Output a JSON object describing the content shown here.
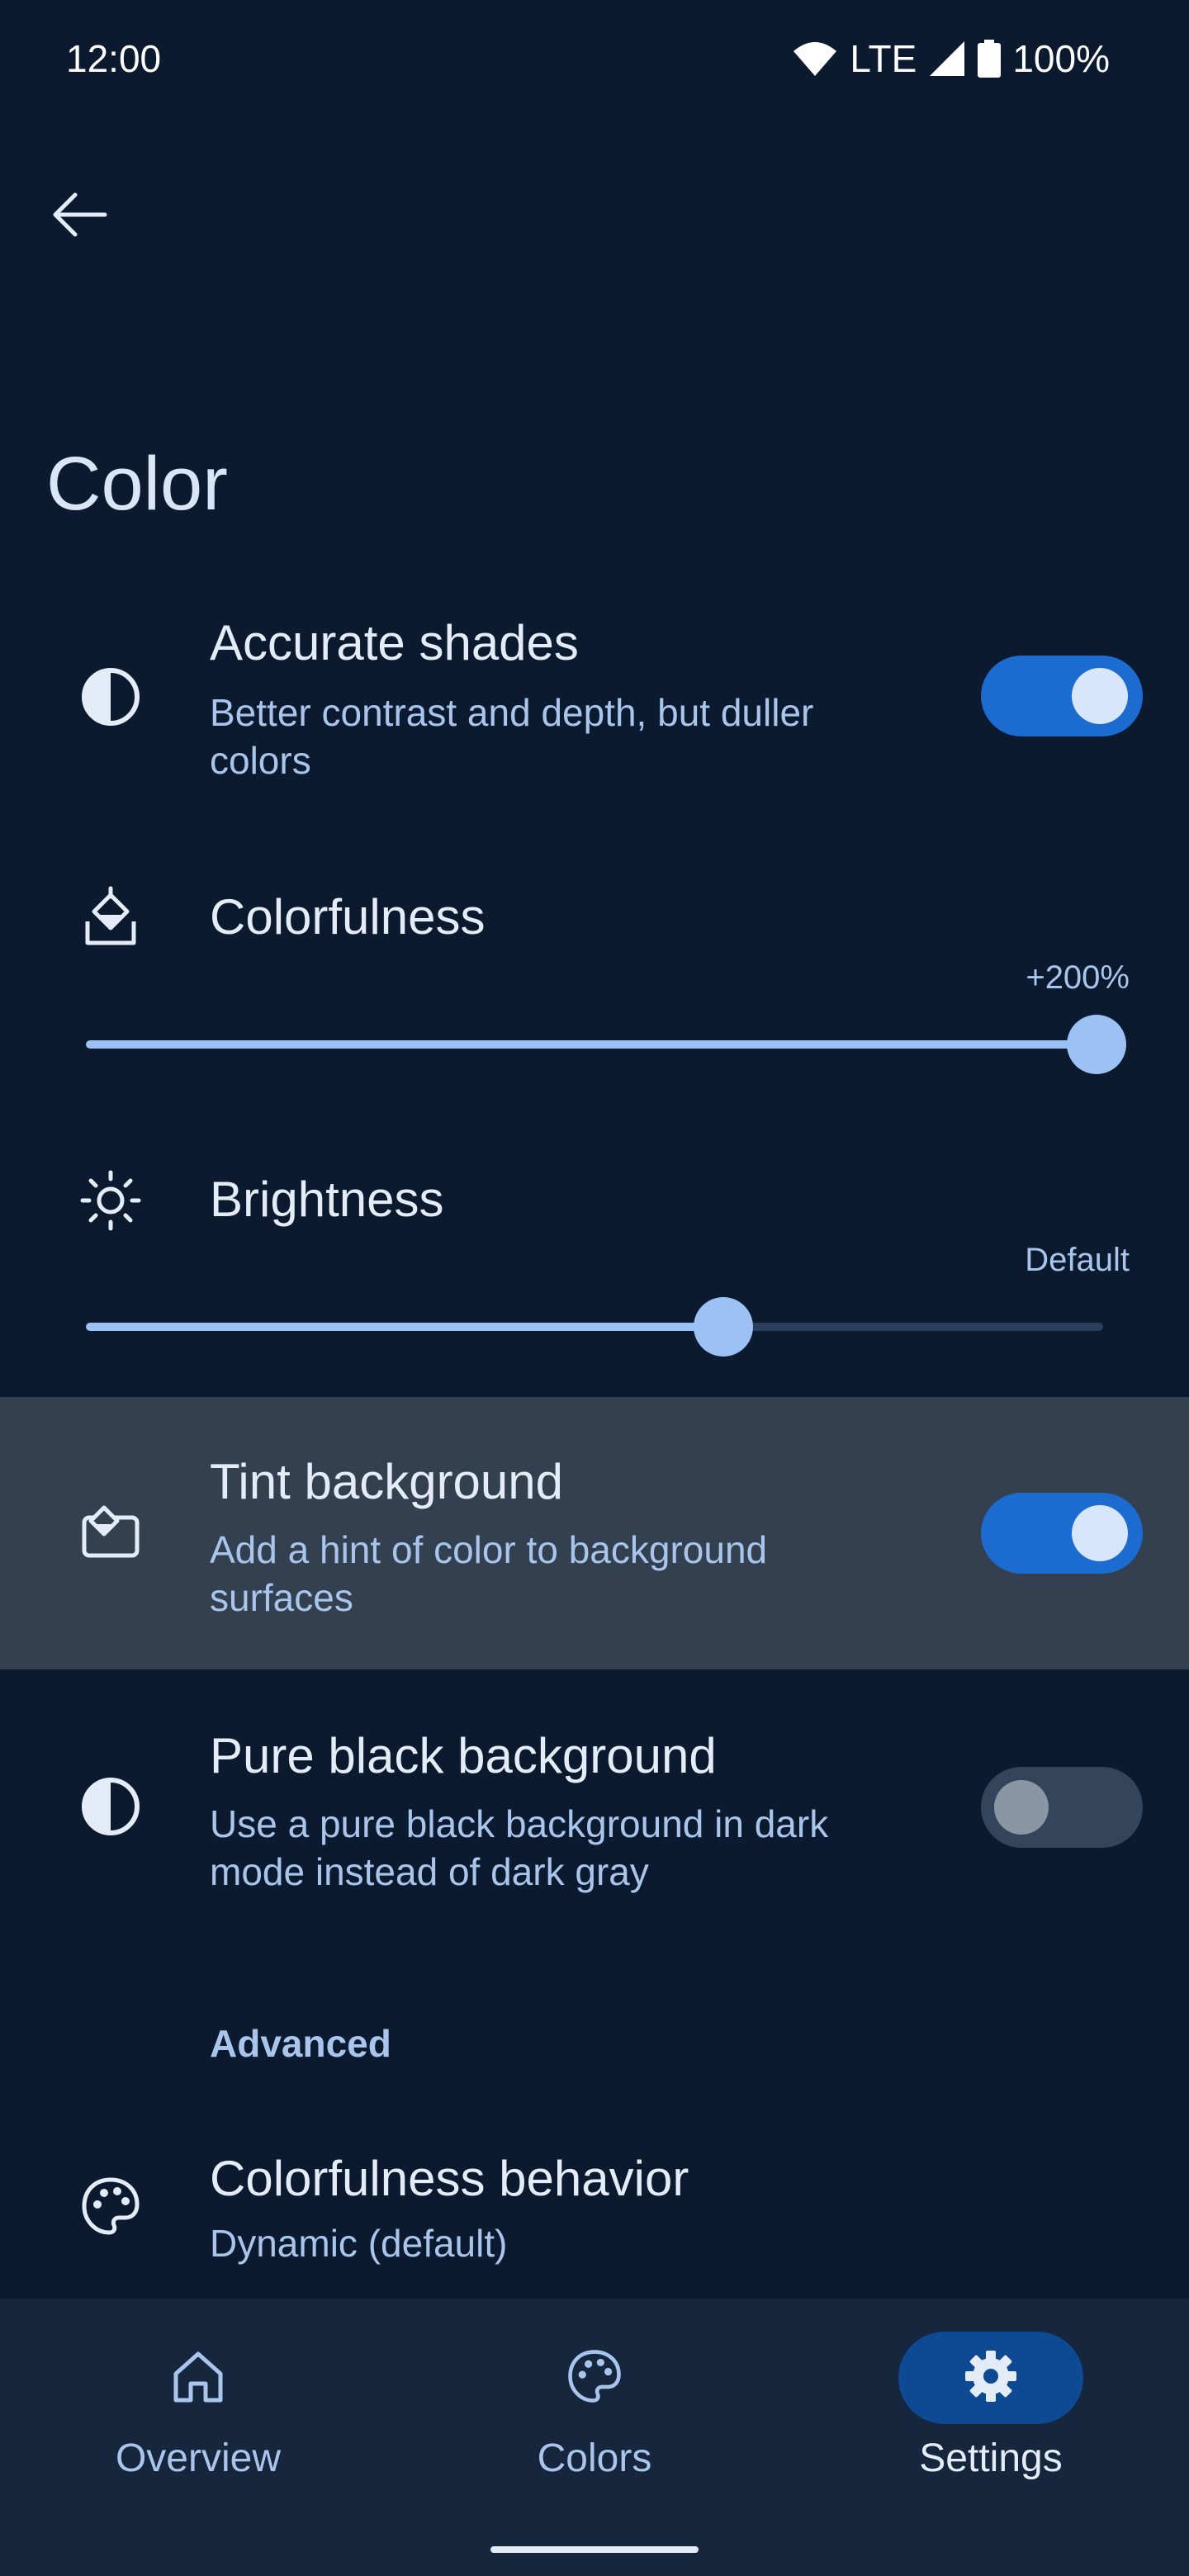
{
  "status_bar": {
    "time": "12:00",
    "network": "LTE",
    "battery": "100%"
  },
  "header": {
    "back_icon": "arrow-left-icon",
    "title": "Color"
  },
  "settings": {
    "accurate_shades": {
      "icon": "contrast-icon",
      "title": "Accurate shades",
      "subtitle_line1": "Better contrast and depth, but duller",
      "subtitle_line2": "colors",
      "enabled": true
    },
    "colorfulness": {
      "icon": "paint-bucket-icon",
      "title": "Colorfulness",
      "value_label": "+200%",
      "level": 1.0
    },
    "brightness": {
      "icon": "brightness-icon",
      "title": "Brightness",
      "value_label": "Default",
      "level": 0.63
    },
    "tint_background": {
      "icon": "tint-surface-icon",
      "title": "Tint background",
      "subtitle_line1": "Add a hint of color to background",
      "subtitle_line2": "surfaces",
      "enabled": true
    },
    "pure_black": {
      "icon": "contrast-icon",
      "title": "Pure black background",
      "subtitle_line1": "Use a pure black background in dark",
      "subtitle_line2": "mode instead of dark gray",
      "enabled": false
    },
    "advanced_header": "Advanced",
    "colorfulness_behavior": {
      "icon": "palette-icon",
      "title": "Colorfulness behavior",
      "subtitle": "Dynamic (default)"
    }
  },
  "bottom_nav": {
    "items": [
      {
        "label": "Overview",
        "icon": "home-icon",
        "active": false
      },
      {
        "label": "Colors",
        "icon": "palette-icon",
        "active": false
      },
      {
        "label": "Settings",
        "icon": "gear-icon",
        "active": true
      }
    ]
  },
  "colors": {
    "background": "#0b1a2e",
    "accent": "#1c6bd1",
    "slider": "#9cc2f5",
    "nav_active": "#0e4a93"
  }
}
